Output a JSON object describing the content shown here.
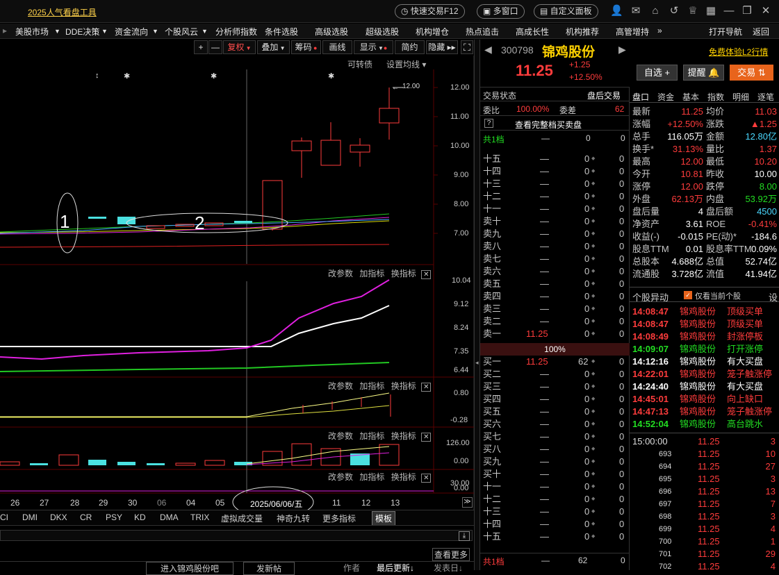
{
  "app": {
    "title": "2025人气看盘工具",
    "buttons": [
      "快速交易F12",
      "多窗口",
      "自定义面板"
    ]
  },
  "menu": [
    "美股市场",
    "DDE决策",
    "资金流向",
    "个股风云",
    "分析师指数",
    "条件选股",
    "高级选股",
    "超级选股",
    "机构增仓",
    "热点追击",
    "高成长性",
    "机构推荐",
    "高管增持",
    "»",
    "打开导航",
    "返回"
  ],
  "chart_toolbar": {
    "buttons": [
      "+",
      "—",
      "复权",
      "叠加",
      "筹码",
      "画线",
      "显示",
      "简约",
      "隐藏"
    ],
    "sub": [
      "可转债",
      "设置均线"
    ]
  },
  "main_panel": {
    "price_label": "12.00",
    "y_ticks": [
      "12.00",
      "11.00",
      "10.00",
      "9.00",
      "8.00",
      "7.00"
    ],
    "annotations": [
      "1",
      "2"
    ],
    "markers": [
      "↕",
      "✱",
      "✱",
      "✱"
    ]
  },
  "indicator_panels": [
    {
      "ticks": [
        "10.04",
        "9.12",
        "8.24",
        "7.35",
        "6.44"
      ],
      "controls": [
        "改参数",
        "加指标",
        "换指标"
      ]
    },
    {
      "ticks": [
        "0.80",
        "-0.28"
      ],
      "controls": [
        "改参数",
        "加指标",
        "换指标"
      ]
    },
    {
      "ticks": [
        "126.00",
        "0.00"
      ],
      "controls": [
        "改参数",
        "加指标",
        "换指标"
      ]
    },
    {
      "ticks": [
        "30.00",
        "0.00"
      ],
      "controls": [
        "改参数",
        "加指标",
        "换指标"
      ]
    }
  ],
  "dates": [
    "26",
    "27",
    "28",
    "29",
    "30",
    "06",
    "04",
    "05",
    "2025/06/06/五",
    "11",
    "12",
    "13"
  ],
  "indicator_tabs": [
    "CI",
    "DMI",
    "DKX",
    "CR",
    "PSY",
    "KD",
    "DMA",
    "TRIX",
    "虚拟成交量",
    "神奇九转",
    "更多指标",
    "模板"
  ],
  "footer": {
    "more": "查看更多",
    "links": [
      "进入锦鸡股份吧",
      "发新帖"
    ],
    "columns": [
      "作者",
      "最后更新↓",
      "发表日↓"
    ]
  },
  "stock": {
    "code": "300798",
    "name": "锦鸡股份",
    "price": "11.25",
    "change": "+1.25",
    "pct": "+12.50%",
    "promo": "免费体验L2行情",
    "btns": [
      "自选 +",
      "提醒",
      "交易"
    ]
  },
  "trade_status": {
    "label": "交易状态",
    "value": "盘后交易",
    "weibi_label": "委比",
    "weibi": "100.00%",
    "weicha_label": "委差",
    "weicha": "62",
    "full_book": "查看完整档买卖盘",
    "total1": "共1档"
  },
  "sells": [
    "十五",
    "十四",
    "十三",
    "十二",
    "十一",
    "卖十",
    "卖九",
    "卖八",
    "卖七",
    "卖六",
    "卖五",
    "卖四",
    "卖三",
    "卖二",
    "卖一"
  ],
  "sell1_price": "11.25",
  "mid_pct": "100%",
  "buys": [
    "买一",
    "买二",
    "买三",
    "买四",
    "买五",
    "买六",
    "买七",
    "买八",
    "买九",
    "买十",
    "十一",
    "十二",
    "十三",
    "十四",
    "十五"
  ],
  "buy1": {
    "price": "11.25",
    "vol": "62"
  },
  "book_dash": "—",
  "book_zero": "0",
  "bottom_total": {
    "label": "共1档",
    "dash": "—",
    "vol": "62",
    "zero": "0"
  },
  "info_tabs": [
    "盘口",
    "资金",
    "基本",
    "指数",
    "明细",
    "逐笔"
  ],
  "info": [
    [
      "最新",
      "11.25",
      "均价",
      "11.03"
    ],
    [
      "涨幅",
      "+12.50%",
      "涨跌",
      "▲1.25"
    ],
    [
      "总手",
      "116.05万",
      "金额",
      "12.80亿"
    ],
    [
      "换手*",
      "31.13%",
      "量比",
      "1.37"
    ],
    [
      "最高",
      "12.00",
      "最低",
      "10.20"
    ],
    [
      "今开",
      "10.81",
      "昨收",
      "10.00"
    ],
    [
      "涨停",
      "12.00",
      "跌停",
      "8.00"
    ],
    [
      "外盘",
      "62.13万",
      "内盘",
      "53.92万"
    ],
    [
      "盘后量",
      "4",
      "盘后额",
      "4500"
    ],
    [
      "净资产",
      "3.61",
      "ROE",
      "-0.41%"
    ],
    [
      "收益(-)",
      "-0.015",
      "PE(动)*",
      "-184.6"
    ],
    [
      "股息TTM",
      "0.01",
      "股息率TTM",
      "0.09%"
    ],
    [
      "总股本",
      "4.688亿",
      "总值",
      "52.74亿"
    ],
    [
      "流通股",
      "3.728亿",
      "流值",
      "41.94亿"
    ]
  ],
  "events": {
    "title": "个股异动",
    "option": "仅看当前个股",
    "set": "设",
    "rows": [
      [
        "14:08:47",
        "锦鸡股份",
        "顶级买单"
      ],
      [
        "14:08:47",
        "锦鸡股份",
        "顶级买单"
      ],
      [
        "14:08:49",
        "锦鸡股份",
        "封涨停板"
      ],
      [
        "14:09:07",
        "锦鸡股份",
        "打开涨停"
      ],
      [
        "14:12:16",
        "锦鸡股份",
        "有大买盘"
      ],
      [
        "14:22:01",
        "锦鸡股份",
        "笼子触涨停"
      ],
      [
        "14:24:40",
        "锦鸡股份",
        "有大买盘"
      ],
      [
        "14:45:01",
        "锦鸡股份",
        "向上缺口"
      ],
      [
        "14:47:13",
        "锦鸡股份",
        "笼子触涨停"
      ],
      [
        "14:52:04",
        "锦鸡股份",
        "高台跳水"
      ]
    ]
  },
  "ticks": [
    [
      "15:00:00",
      "11.25",
      "3"
    ],
    [
      "693",
      "11.25",
      "10"
    ],
    [
      "694",
      "11.25",
      "27"
    ],
    [
      "695",
      "11.25",
      "3"
    ],
    [
      "696",
      "11.25",
      "13"
    ],
    [
      "697",
      "11.25",
      "7"
    ],
    [
      "698",
      "11.25",
      "3"
    ],
    [
      "699",
      "11.25",
      "4"
    ],
    [
      "700",
      "11.25",
      "1"
    ],
    [
      "701",
      "11.25",
      "29"
    ],
    [
      "702",
      "11.25",
      "4"
    ]
  ],
  "colors": {
    "up": "#ff3c3c",
    "down": "#22dd22",
    "accent": "#ffd24a",
    "cyan": "#4ad8ff"
  }
}
